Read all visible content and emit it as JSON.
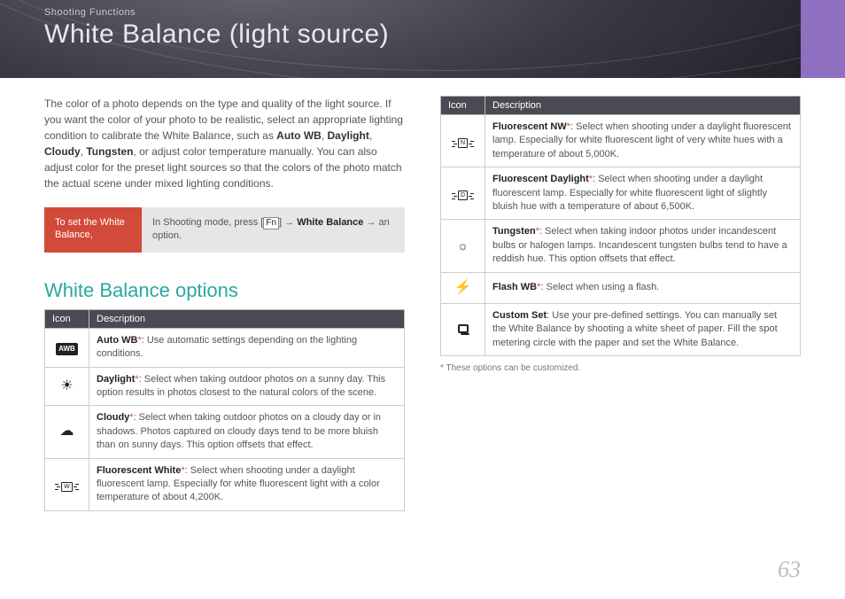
{
  "header": {
    "breadcrumb": "Shooting Functions",
    "title": "White Balance (light source)"
  },
  "intro": {
    "p1a": "The color of a photo depends on the type and quality of the light source. If you want the color of your photo to be realistic, select an appropriate lighting condition to calibrate the White Balance, such as ",
    "b1": "Auto WB",
    "sep1": ", ",
    "b2": "Daylight",
    "sep2": ", ",
    "b3": "Cloudy",
    "sep3": ", ",
    "b4": "Tungsten",
    "p1b": ", or adjust color temperature manually. You can also adjust color for the preset light sources so that the colors of the photo match the actual scene under mixed lighting conditions."
  },
  "instruction": {
    "label": "To set the White Balance,",
    "text_a": "In Shooting mode, press [",
    "fn": "Fn",
    "text_b": "] → ",
    "bold": "White Balance",
    "text_c": " → an option."
  },
  "options_heading": "White Balance options",
  "table_headers": {
    "icon": "Icon",
    "desc": "Description"
  },
  "left_rows": [
    {
      "icon_name": "auto-wb-icon",
      "glyph": "AWB",
      "title": "Auto WB",
      "star": "*",
      "text": ": Use automatic settings depending on the lighting conditions."
    },
    {
      "icon_name": "daylight-icon",
      "glyph": "☀",
      "title": "Daylight",
      "star": "*",
      "text": ": Select when taking outdoor photos on a sunny day. This option results in photos closest to the natural colors of the scene."
    },
    {
      "icon_name": "cloudy-icon",
      "glyph": "☁",
      "title": "Cloudy",
      "star": "*",
      "text": ": Select when taking outdoor photos on a cloudy day or in shadows. Photos captured on cloudy days tend to be more bluish than on sunny days. This option offsets that effect."
    },
    {
      "icon_name": "fluorescent-white-icon",
      "glyph": "W",
      "title": "Fluorescent White",
      "star": "*",
      "text": ": Select when shooting under a daylight fluorescent lamp. Especially for white fluorescent light with a color temperature of about 4,200K."
    }
  ],
  "right_rows": [
    {
      "icon_name": "fluorescent-nw-icon",
      "glyph": "N",
      "title": "Fluorescent NW",
      "star": "*",
      "text": ": Select when shooting under a daylight fluorescent lamp. Especially for white fluorescent light of very white hues with a temperature of about 5,000K."
    },
    {
      "icon_name": "fluorescent-daylight-icon",
      "glyph": "D",
      "title": "Fluorescent Daylight",
      "star": "*",
      "text": ": Select when shooting under a daylight fluorescent lamp. Especially for white fluorescent light of slightly bluish hue with a temperature of about 6,500K."
    },
    {
      "icon_name": "tungsten-icon",
      "glyph": "bulb",
      "title": "Tungsten",
      "star": "*",
      "text": ": Select when taking indoor photos under incandescent bulbs or halogen lamps. Incandescent tungsten bulbs tend to have a reddish hue. This option offsets that effect."
    },
    {
      "icon_name": "flash-wb-icon",
      "glyph": "⚡",
      "title": "Flash WB",
      "star": "*",
      "text": ": Select when using a flash."
    },
    {
      "icon_name": "custom-set-icon",
      "glyph": "custom",
      "title": "Custom Set",
      "star": "",
      "text": ": Use your pre-defined settings. You can manually set the White Balance by shooting a white sheet of paper. Fill the spot metering circle with the paper and set the White Balance."
    }
  ],
  "footnote": "* These options can be customized.",
  "page_number": "63"
}
